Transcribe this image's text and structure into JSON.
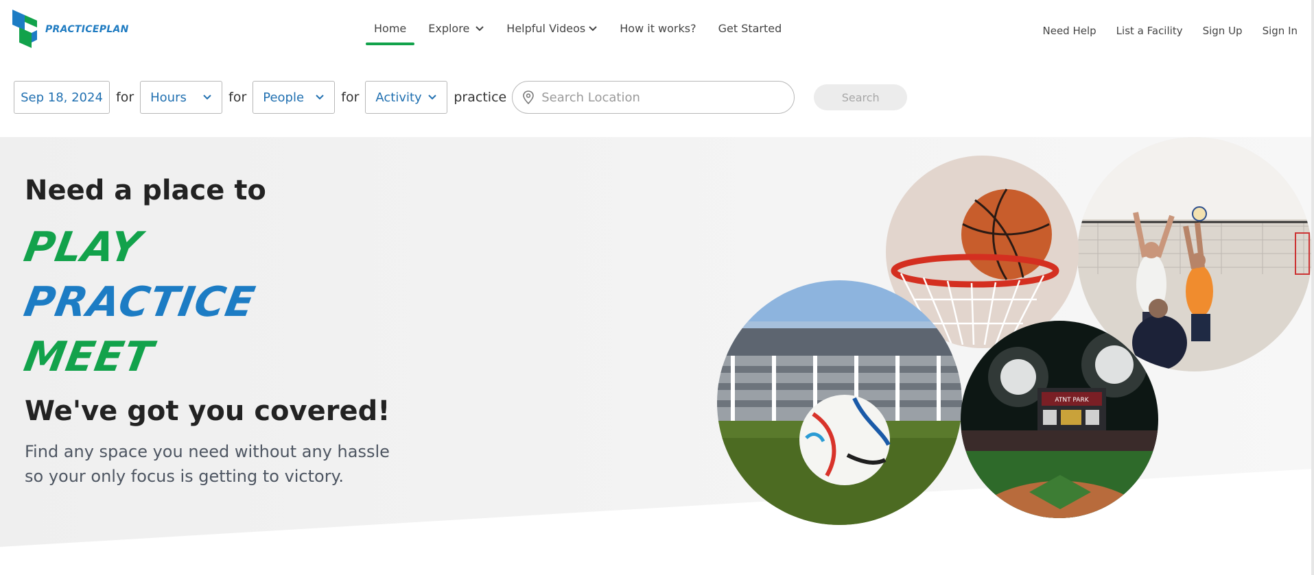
{
  "brand": {
    "name": "PRACTICEPLAN",
    "green": "#12a24b",
    "blue": "#1c7cc4"
  },
  "nav": {
    "home": "Home",
    "explore": "Explore",
    "videos": "Helpful Videos",
    "how": "How it works?",
    "start": "Get Started"
  },
  "util": {
    "help": "Need Help",
    "list": "List a Facility",
    "signup": "Sign Up",
    "signin": "Sign In"
  },
  "search": {
    "date": "Sep 18, 2024",
    "for": "for",
    "hours": "Hours",
    "people": "People",
    "activity": "Activity",
    "practice": "practice",
    "location_placeholder": "Search Location",
    "button": "Search"
  },
  "hero": {
    "lead": "Need a place to",
    "word1": "PLAY",
    "word2": "PRACTICE",
    "word3": "MEET",
    "tail": "We've got you covered!",
    "desc1": "Find any space you need without any hassle",
    "desc2": "so your only focus is getting to victory."
  },
  "images": {
    "basketball": "basketball-hoop-photo",
    "volleyball": "volleyball-players-photo",
    "soccer": "soccer-ball-stadium-photo",
    "baseball": "baseball-stadium-night-photo",
    "scoreboard": "ATNT PARK"
  }
}
